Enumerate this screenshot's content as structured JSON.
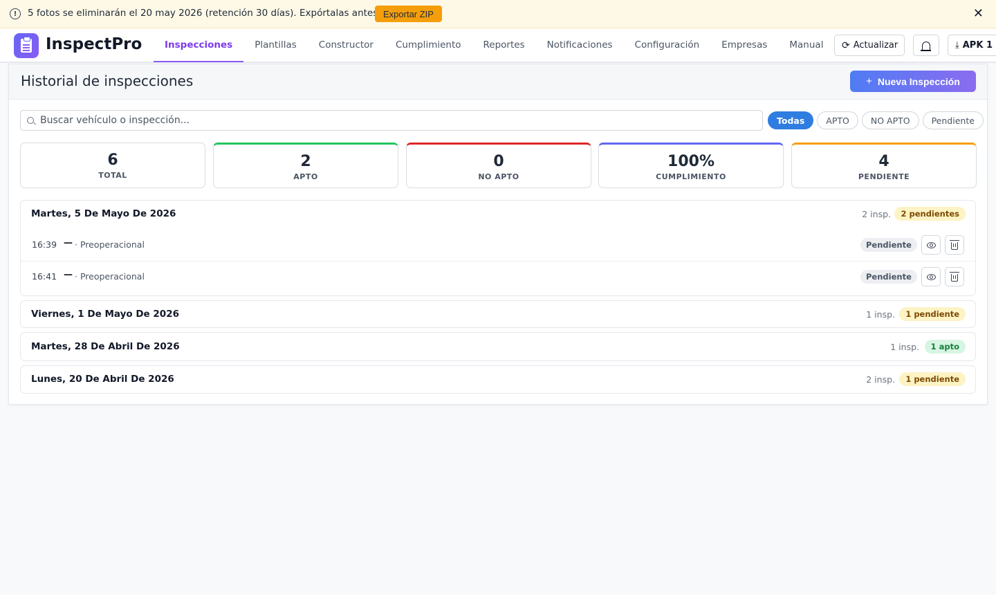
{
  "banner": {
    "message": "5 fotos se eliminarán el 20 may 2026 (retención 30 días). Expórtalas antes.",
    "export_label": "Exportar ZIP",
    "close_icon": "close-icon"
  },
  "header": {
    "brand": "InspectPro",
    "tabs": [
      "Inspecciones",
      "Plantillas",
      "Constructor",
      "Cumplimiento",
      "Reportes",
      "Notificaciones",
      "Configuración",
      "Empresas",
      "Manual"
    ],
    "active_tab": "Inspecciones",
    "refresh_label": "Actualizar",
    "apk_label": "APK 1"
  },
  "main": {
    "title": "Historial de inspecciones",
    "new_button": "Nueva Inspección",
    "search_placeholder": "Buscar vehículo o inspección...",
    "filters": [
      "Todas",
      "APTO",
      "NO APTO",
      "Pendiente"
    ],
    "active_filter": "Todas",
    "stats": [
      {
        "value": "6",
        "label": "TOTAL",
        "accent": ""
      },
      {
        "value": "2",
        "label": "APTO",
        "accent": "#22c55e"
      },
      {
        "value": "0",
        "label": "NO APTO",
        "accent": "#dc2626"
      },
      {
        "value": "100%",
        "label": "CUMPLIMIENTO",
        "accent": "#6366f1"
      },
      {
        "value": "4",
        "label": "PENDIENTE",
        "accent": "#f59e0b"
      }
    ],
    "groups": [
      {
        "title": "Martes, 5 De Mayo De 2026",
        "count": "2 insp.",
        "badge": "2 pendientes",
        "badge_kind": "pend",
        "rows": [
          {
            "time": "16:39",
            "dash": "—",
            "type": "· Preoperacional",
            "status": "Pendiente"
          },
          {
            "time": "16:41",
            "dash": "—",
            "type": "· Preoperacional",
            "status": "Pendiente"
          }
        ]
      },
      {
        "title": "Viernes, 1 De Mayo De 2026",
        "count": "1 insp.",
        "badge": "1 pendiente",
        "badge_kind": "pend",
        "rows": []
      },
      {
        "title": "Martes, 28 De Abril De 2026",
        "count": "1 insp.",
        "badge": "1 apto",
        "badge_kind": "apto",
        "rows": []
      },
      {
        "title": "Lunes, 20 De Abril De 2026",
        "count": "2 insp.",
        "badge": "1 pendiente",
        "badge_kind": "pend",
        "rows": []
      }
    ]
  },
  "colors": {
    "brand_gradient_start": "#6366f1",
    "brand_gradient_end": "#8b5cf6",
    "active_tab": "#7c3aed",
    "filter_active": "#2f7de1",
    "export_button": "#f59e0b"
  }
}
